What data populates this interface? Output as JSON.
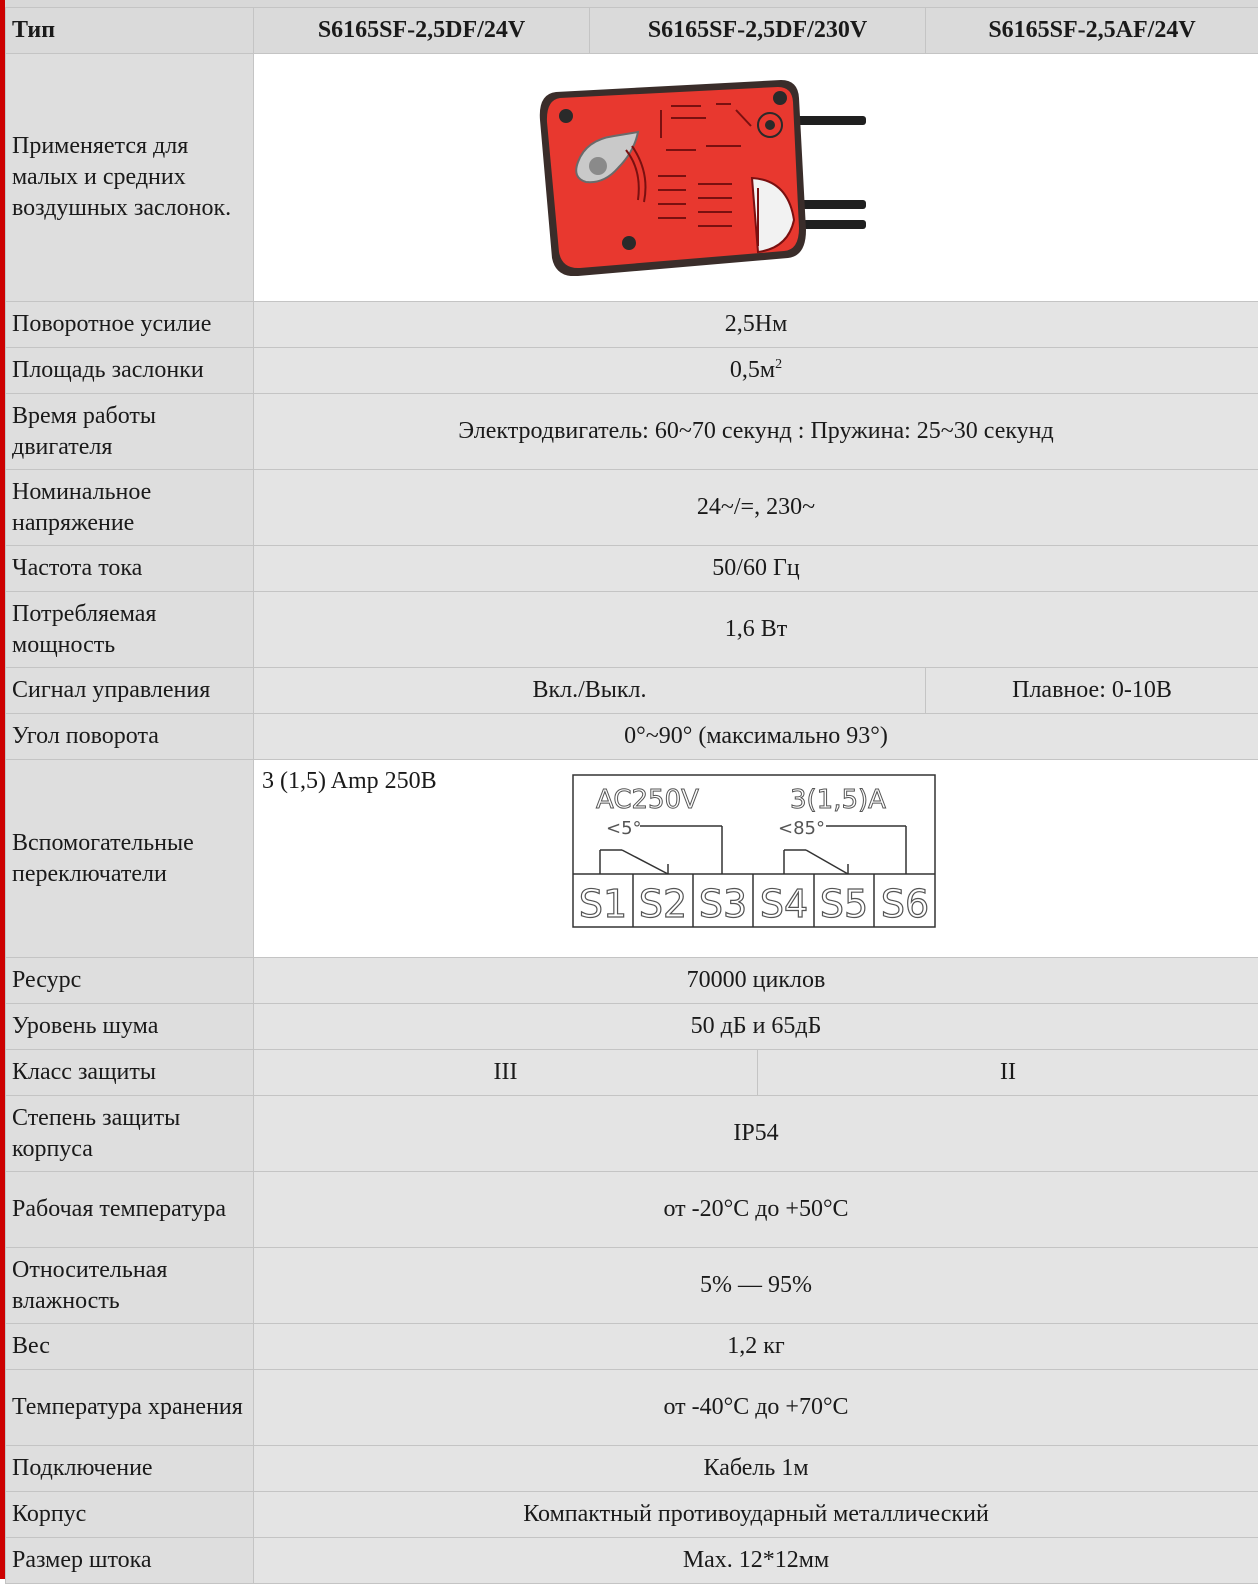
{
  "header": {
    "type_label": "Тип",
    "models": [
      "S6165SF-2,5DF/24V",
      "S6165SF-2,5DF/230V",
      "S6165SF-2,5AF/24V"
    ]
  },
  "application": {
    "label": "Применяется для малых и средних воздушных заслонок."
  },
  "rows": {
    "torque": {
      "label": "Поворотное усилие",
      "value": "2,5Нм"
    },
    "area": {
      "label": "Площадь заслонки",
      "value": "0,5м",
      "sup": "2"
    },
    "run_time": {
      "label": "Время работы двигателя",
      "value": "Электродвигатель: 60~70 секунд : Пружина: 25~30 секунд"
    },
    "voltage": {
      "label": "Номинальное напряжение",
      "value": "24~/=, 230~"
    },
    "frequency": {
      "label": "Частота тока",
      "value": "50/60 Гц"
    },
    "power": {
      "label": "Потребляемая мощность",
      "value": "1,6 Вт"
    },
    "control": {
      "label": "Сигнал управления",
      "value_onoff": "Вкл./Выкл.",
      "value_mod": "Плавное:  0-10В"
    },
    "angle": {
      "label": "Угол поворота",
      "value": "0°~90° (максимально 93°)"
    },
    "aux": {
      "label": "Вспомогательные переключатели",
      "value": "3 (1,5) Amp 250В"
    },
    "resource": {
      "label": "Ресурс",
      "value": "70000 циклов"
    },
    "noise": {
      "label": "Уровень шума",
      "value": "50 дБ и 65дБ"
    },
    "prot_class": {
      "label": "Класс защиты",
      "value_a": "III",
      "value_b": "II"
    },
    "ip": {
      "label": "Степень защиты корпуса",
      "value": "IP54"
    },
    "op_temp": {
      "label": "Рабочая температура",
      "value": "от -20°C до +50°C"
    },
    "humidity": {
      "label": "Относительная влажность",
      "value": "5% — 95%"
    },
    "weight": {
      "label": "Вес",
      "value": "1,2 кг"
    },
    "storage_temp": {
      "label": "Температура хранения",
      "value": "от -40°C до +70°C"
    },
    "connection": {
      "label": "Подключение",
      "value": "Кабель 1м"
    },
    "housing": {
      "label": "Корпус",
      "value": "Компактный противоударный металлический"
    },
    "shaft": {
      "label": "Размер штока",
      "value": "Max. 12*12мм"
    }
  },
  "diagram": {
    "rating_left": "AC250V",
    "rating_right": "3(1,5)A",
    "angle_left": "<5°",
    "angle_right": "<85°",
    "terminals": [
      "S1",
      "S2",
      "S3",
      "S4",
      "S5",
      "S6"
    ]
  },
  "colors": {
    "accent_bar": "#cc0000",
    "actuator_body": "#e8382f",
    "label_bg": "#dedede",
    "value_bg": "#e4e4e4"
  }
}
